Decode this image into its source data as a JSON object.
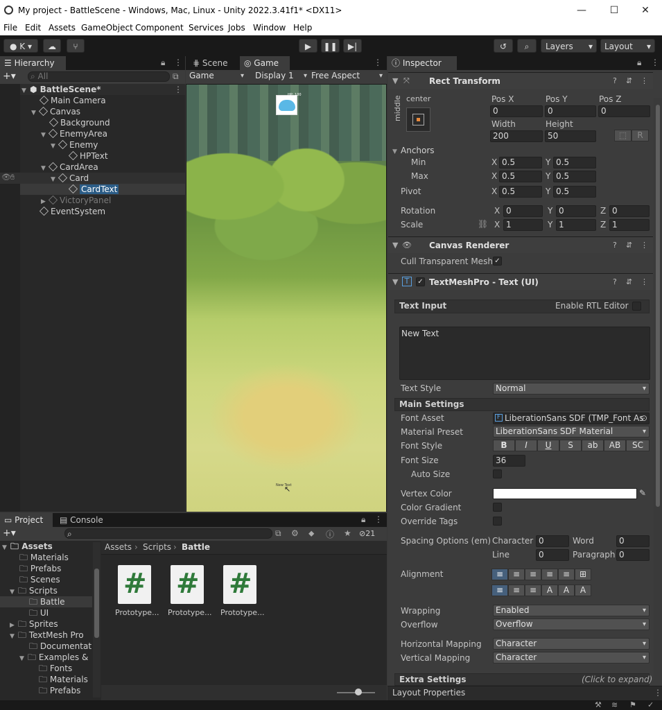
{
  "window": {
    "title": "My project - BattleScene - Windows, Mac, Linux - Unity 2022.3.41f1* <DX11>",
    "min": "—",
    "max": "☐",
    "close": "✕"
  },
  "menu": [
    "File",
    "Edit",
    "Assets",
    "GameObject",
    "Component",
    "Services",
    "Jobs",
    "Window",
    "Help"
  ],
  "toolbar": {
    "account": "K",
    "layers": "Layers",
    "layout": "Layout"
  },
  "hierarchy": {
    "tab": "Hierarchy",
    "search_placeholder": "All",
    "items": [
      "BattleScene*",
      "Main Camera",
      "Canvas",
      "Background",
      "EnemyArea",
      "Enemy",
      "HPText",
      "CardArea",
      "Card",
      "CardText",
      "VictoryPanel",
      "EventSystem"
    ]
  },
  "scene_tabs": {
    "scene": "Scene",
    "game": "Game"
  },
  "game_bar": {
    "mode": "Game",
    "display": "Display 1",
    "aspect": "Free Aspect"
  },
  "game_view": {
    "enemy_hp": "HP: 100",
    "card_text": "New Text"
  },
  "project": {
    "tab": "Project",
    "console_tab": "Console",
    "hidden_count": "21",
    "breadcrumb": [
      "Assets",
      "Scripts",
      "Battle"
    ],
    "tree": [
      "Assets",
      "Materials",
      "Prefabs",
      "Scenes",
      "Scripts",
      "Battle",
      "UI",
      "Sprites",
      "TextMesh Pro",
      "Documentati",
      "Examples & E",
      "Fonts",
      "Materials",
      "Prefabs"
    ],
    "files": [
      "Prototype...",
      "Prototype...",
      "Prototype..."
    ]
  },
  "inspector": {
    "tab": "Inspector",
    "rect_transform": {
      "title": "Rect Transform",
      "anchor_h": "center",
      "anchor_v": "middle",
      "posx_label": "Pos X",
      "posy_label": "Pos Y",
      "posz_label": "Pos Z",
      "posx": "0",
      "posy": "0",
      "posz": "0",
      "width_label": "Width",
      "height_label": "Height",
      "width": "200",
      "height": "50",
      "r": "R",
      "anchors": "Anchors",
      "min": "Min",
      "max": "Max",
      "min_x": "0.5",
      "min_y": "0.5",
      "max_x": "0.5",
      "max_y": "0.5",
      "pivot": "Pivot",
      "pivot_x": "0.5",
      "pivot_y": "0.5",
      "rotation": "Rotation",
      "rot_x": "0",
      "rot_y": "0",
      "rot_z": "0",
      "scale": "Scale",
      "scale_x": "1",
      "scale_y": "1",
      "scale_z": "1"
    },
    "canvas_renderer": {
      "title": "Canvas Renderer",
      "cull": "Cull Transparent Mesh"
    },
    "tmp": {
      "title": "TextMeshPro - Text (UI)",
      "text_input": "Text Input",
      "rtl": "Enable RTL Editor",
      "text": "New Text",
      "text_style_label": "Text Style",
      "text_style": "Normal",
      "main_settings": "Main Settings",
      "font_asset_label": "Font Asset",
      "font_asset": "LiberationSans SDF (TMP_Font As",
      "material_preset_label": "Material Preset",
      "material_preset": "LiberationSans SDF Material",
      "font_style_label": "Font Style",
      "font_styles": [
        "B",
        "I",
        "U",
        "S",
        "ab",
        "AB",
        "SC"
      ],
      "font_size_label": "Font Size",
      "font_size": "36",
      "auto_size": "Auto Size",
      "vertex_color": "Vertex Color",
      "color_gradient": "Color Gradient",
      "override_tags": "Override Tags",
      "spacing_label": "Spacing Options (em)",
      "character_label": "Character",
      "character": "0",
      "word_label": "Word",
      "word": "0",
      "line_label": "Line",
      "line": "0",
      "paragraph_label": "Paragraph",
      "paragraph": "0",
      "alignment": "Alignment",
      "wrapping_label": "Wrapping",
      "wrapping": "Enabled",
      "overflow_label": "Overflow",
      "overflow": "Overflow",
      "hmap_label": "Horizontal Mapping",
      "hmap": "Character",
      "vmap_label": "Vertical Mapping",
      "vmap": "Character",
      "extra": "Extra Settings",
      "extra_hint": "(Click to expand)"
    },
    "layout_props": "Layout Properties"
  }
}
